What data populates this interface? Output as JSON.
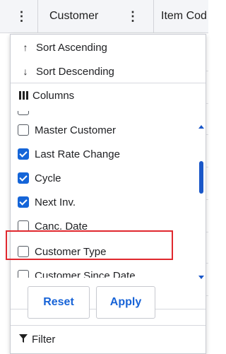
{
  "header": {
    "menu_glyph": "⋮",
    "customer_label": "Customer",
    "customer_menu_glyph": "⋮",
    "item_label": "Item Cod"
  },
  "menu": {
    "sort_ascending": {
      "icon": "↑",
      "label": "Sort Ascending"
    },
    "sort_descending": {
      "icon": "↓",
      "label": "Sort Descending"
    },
    "columns": {
      "label": "Columns"
    },
    "columns_list": [
      {
        "label": "Master Customer",
        "checked": false
      },
      {
        "label": "Last Rate Change",
        "checked": true
      },
      {
        "label": "Cycle",
        "checked": true
      },
      {
        "label": "Next Inv.",
        "checked": true
      },
      {
        "label": "Canc. Date",
        "checked": false
      },
      {
        "label": "Customer Type",
        "checked": false
      },
      {
        "label": "Customer Since Date",
        "checked": false
      }
    ],
    "buttons": {
      "reset": "Reset",
      "apply": "Apply"
    },
    "filter": {
      "icon": "filter-icon",
      "label": "Filter"
    }
  },
  "colors": {
    "accent": "#1565d8",
    "highlight": "#e0282e"
  }
}
